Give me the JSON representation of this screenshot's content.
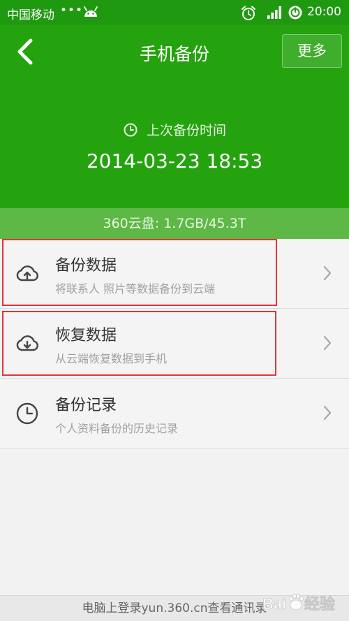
{
  "status_bar": {
    "carrier": "中国移动",
    "dots": "•••",
    "time": "20:00",
    "icons": [
      "android-icon",
      "alarm-icon",
      "signal-icon",
      "sync-icon"
    ]
  },
  "navbar": {
    "back_icon": "chevron-left-icon",
    "title": "手机备份",
    "more_label": "更多"
  },
  "backup_info": {
    "label": "上次备份时间",
    "time": "2014-03-23 18:53"
  },
  "storage": {
    "text": "360云盘: 1.7GB/45.3T"
  },
  "list": [
    {
      "icon": "cloud-upload-icon",
      "title": "备份数据",
      "subtitle": "将联系人 照片等数据备份到云端"
    },
    {
      "icon": "cloud-download-icon",
      "title": "恢复数据",
      "subtitle": "从云端恢复数据到手机"
    },
    {
      "icon": "clock-icon",
      "title": "备份记录",
      "subtitle": "个人资料备份的历史记录"
    }
  ],
  "footer": {
    "text": "电脑上登录yun.360.cn查看通讯录"
  },
  "watermark": {
    "text": "Baidu 经验"
  },
  "colors": {
    "status_bar": "#1f9a10",
    "header_green": "#25a30f",
    "storage_bar": "#5db845",
    "highlight_red": "#e0353a",
    "list_bg": "#f4f4f4"
  }
}
